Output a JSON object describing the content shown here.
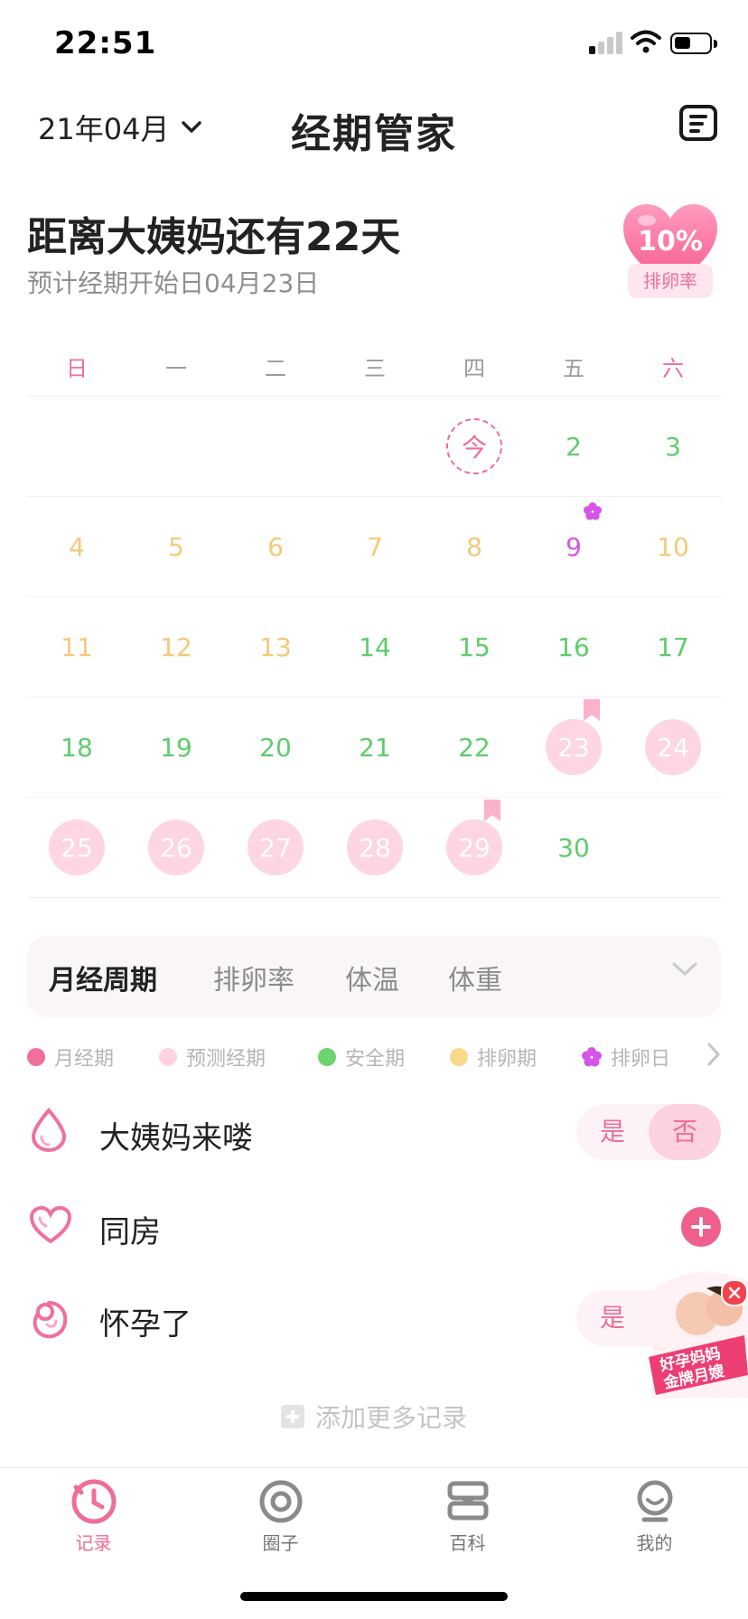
{
  "status_bar": {
    "time": "22:51"
  },
  "header": {
    "month": "21年04月",
    "title": "经期管家"
  },
  "countdown": {
    "title": "距离大姨妈还有22天",
    "subtitle": "预计经期开始日04月23日",
    "ovulation_rate": "10%",
    "ovulation_label": "排卵率"
  },
  "calendar": {
    "weekdays": [
      "日",
      "一",
      "二",
      "三",
      "四",
      "五",
      "六"
    ],
    "weeks": [
      [
        {
          "label": ""
        },
        {
          "label": ""
        },
        {
          "label": ""
        },
        {
          "label": ""
        },
        {
          "label": "今",
          "type": "today"
        },
        {
          "label": "2",
          "type": "safe"
        },
        {
          "label": "3",
          "type": "safe"
        }
      ],
      [
        {
          "label": "4",
          "type": "fertile"
        },
        {
          "label": "5",
          "type": "fertile"
        },
        {
          "label": "6",
          "type": "fertile"
        },
        {
          "label": "7",
          "type": "fertile"
        },
        {
          "label": "8",
          "type": "fertile"
        },
        {
          "label": "9",
          "type": "ovulation-day"
        },
        {
          "label": "10",
          "type": "fertile"
        }
      ],
      [
        {
          "label": "11",
          "type": "fertile"
        },
        {
          "label": "12",
          "type": "fertile"
        },
        {
          "label": "13",
          "type": "fertile"
        },
        {
          "label": "14",
          "type": "safe"
        },
        {
          "label": "15",
          "type": "safe"
        },
        {
          "label": "16",
          "type": "safe"
        },
        {
          "label": "17",
          "type": "safe"
        }
      ],
      [
        {
          "label": "18",
          "type": "safe"
        },
        {
          "label": "19",
          "type": "safe"
        },
        {
          "label": "20",
          "type": "safe"
        },
        {
          "label": "21",
          "type": "safe"
        },
        {
          "label": "22",
          "type": "safe"
        },
        {
          "label": "23",
          "type": "predicted",
          "bookmark": true
        },
        {
          "label": "24",
          "type": "predicted"
        }
      ],
      [
        {
          "label": "25",
          "type": "predicted"
        },
        {
          "label": "26",
          "type": "predicted"
        },
        {
          "label": "27",
          "type": "predicted"
        },
        {
          "label": "28",
          "type": "predicted"
        },
        {
          "label": "29",
          "type": "predicted",
          "bookmark": true
        },
        {
          "label": "30",
          "type": "safe"
        },
        {
          "label": ""
        }
      ]
    ]
  },
  "tabs": [
    "月经周期",
    "排卵率",
    "体温",
    "体重"
  ],
  "legend": [
    {
      "label": "月经期",
      "color": "#f0709a",
      "shape": "dot"
    },
    {
      "label": "预测经期",
      "color": "#fdd3e0",
      "shape": "dot"
    },
    {
      "label": "安全期",
      "color": "#6dd46f",
      "shape": "dot"
    },
    {
      "label": "排卵期",
      "color": "#fad98b",
      "shape": "dot"
    },
    {
      "label": "排卵日",
      "color": "#d555e6",
      "shape": "flower"
    }
  ],
  "records": {
    "period": {
      "label": "大姨妈来喽",
      "icon": "drop-icon",
      "yes": "是",
      "no": "否"
    },
    "intimacy": {
      "label": "同房",
      "icon": "heart-icon"
    },
    "pregnant": {
      "label": "怀孕了",
      "icon": "fetus-icon",
      "yes": "是"
    },
    "add_more": "添加更多记录"
  },
  "ad": {
    "line1": "好孕妈妈",
    "line2": "金牌月嫂"
  },
  "nav": [
    {
      "label": "记录",
      "icon": "clock-icon",
      "active": true
    },
    {
      "label": "圈子",
      "icon": "circle-icon"
    },
    {
      "label": "百科",
      "icon": "book-icon"
    },
    {
      "label": "我的",
      "icon": "profile-icon"
    }
  ],
  "colors": {
    "accent": "#ef6e95",
    "safe": "#5fcd6b",
    "fertile": "#f4c979",
    "predicted": "#fdd6e2",
    "ovulation_day": "#d555e6"
  }
}
